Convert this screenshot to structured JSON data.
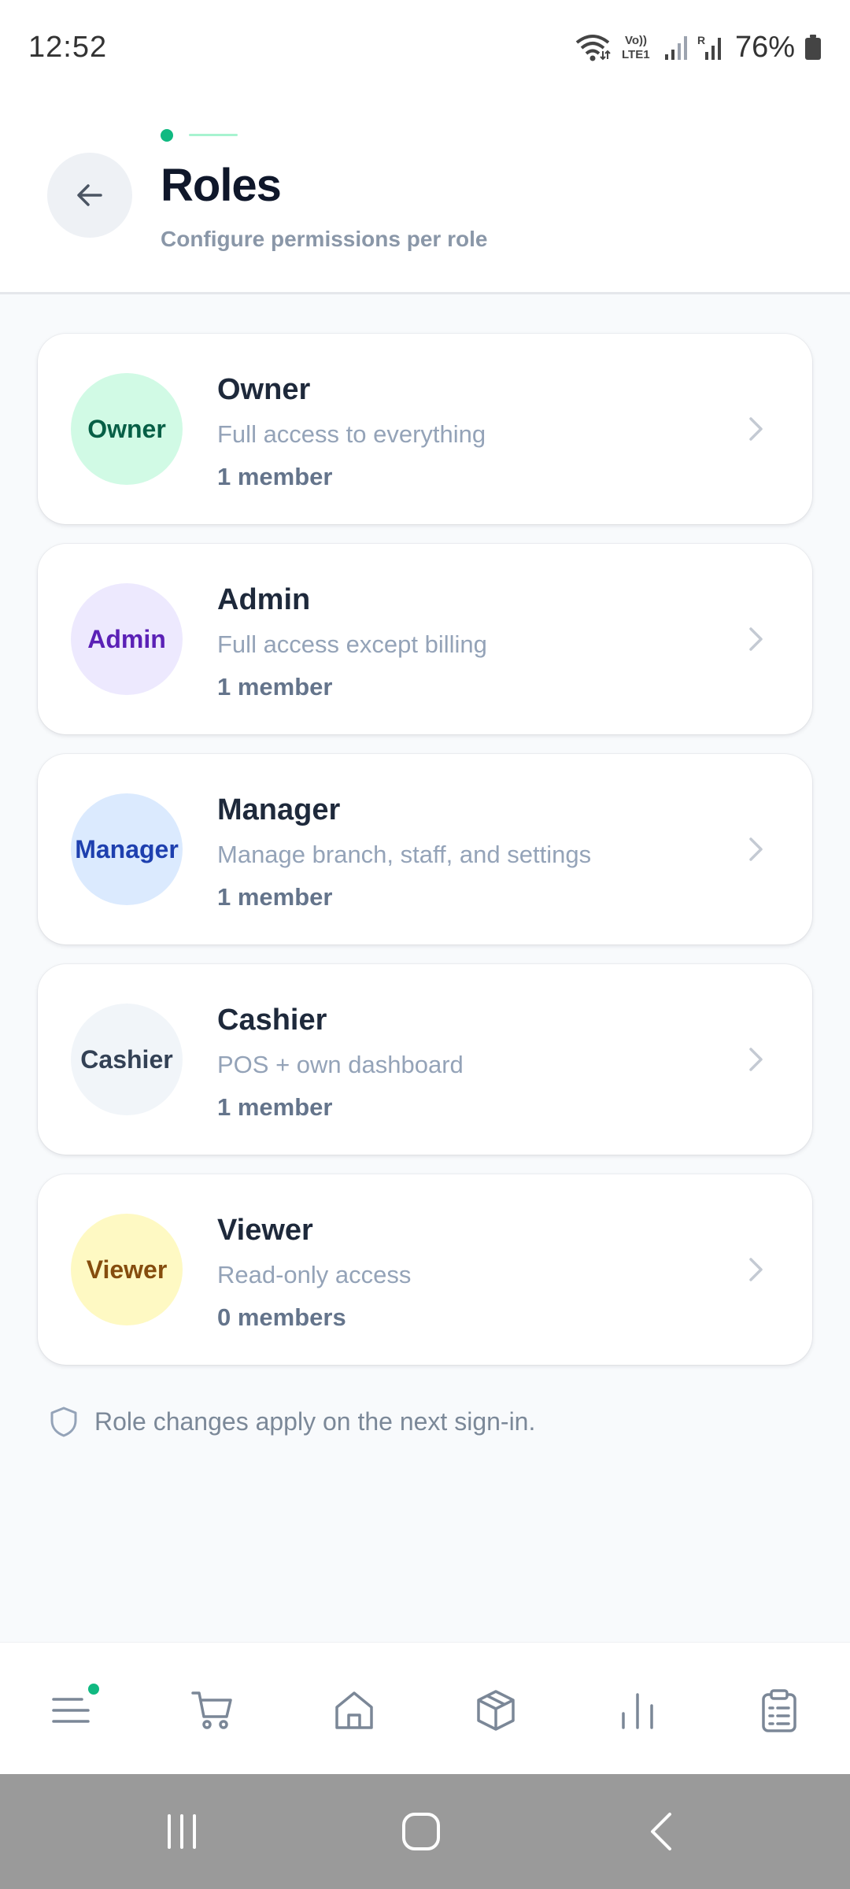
{
  "status_bar": {
    "time": "12:52",
    "battery_percent": "76%",
    "icons": [
      "wifi-icon",
      "volte-icon",
      "signal-icon",
      "signal-roaming-icon",
      "battery-icon"
    ]
  },
  "header": {
    "title": "Roles",
    "subtitle": "Configure permissions per role",
    "back_icon": "arrow-left-icon"
  },
  "roles": [
    {
      "badge": "Owner",
      "name": "Owner",
      "description": "Full access to everything",
      "members": "1 member",
      "colors": {
        "bg": "#d1fae5",
        "fg": "#065f46"
      }
    },
    {
      "badge": "Admin",
      "name": "Admin",
      "description": "Full access except billing",
      "members": "1 member",
      "colors": {
        "bg": "#ede9fe",
        "fg": "#5b21b6"
      }
    },
    {
      "badge": "Manager",
      "name": "Manager",
      "description": "Manage branch, staff, and settings",
      "members": "1 member",
      "colors": {
        "bg": "#dbeafe",
        "fg": "#1e40af"
      }
    },
    {
      "badge": "Cashier",
      "name": "Cashier",
      "description": "POS + own dashboard",
      "members": "1 member",
      "colors": {
        "bg": "#f1f5f9",
        "fg": "#334155"
      }
    },
    {
      "badge": "Viewer",
      "name": "Viewer",
      "description": "Read-only access",
      "members": "0 members",
      "colors": {
        "bg": "#fef9c3",
        "fg": "#854d0e"
      }
    }
  ],
  "note": {
    "icon": "shield-icon",
    "text": "Role changes apply on the next sign-in."
  },
  "bottom_nav": {
    "items": [
      "menu-icon",
      "cart-icon",
      "home-icon",
      "box-icon",
      "bar-chart-icon",
      "clipboard-icon"
    ],
    "accent": "#10b981"
  },
  "system_nav": {
    "items": [
      "recent-apps-icon",
      "home-button-icon",
      "back-button-icon"
    ]
  }
}
